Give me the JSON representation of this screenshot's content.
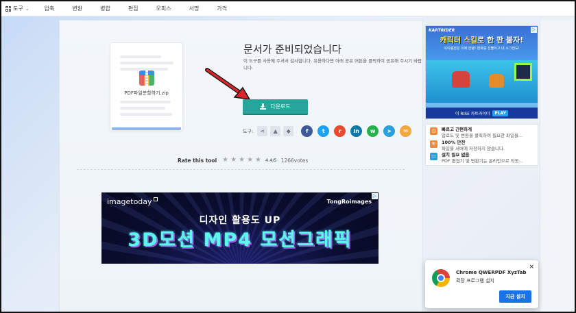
{
  "nav": {
    "tools_label": "도구",
    "items": [
      "압축",
      "변환",
      "병합",
      "편집",
      "오피스",
      "서명",
      "가격"
    ]
  },
  "file": {
    "name": "PDF파일분할하기.zip"
  },
  "result": {
    "title": "문서가 준비되었습니다",
    "subtitle": "이 도구를 사용해 주셔서 감사합니다. 유용하다면 아래 공유 버튼을 클릭하여 공유해 주시기 바랍니다."
  },
  "download": {
    "label": "다운로드"
  },
  "share": {
    "label": "도구:",
    "services": [
      {
        "name": "facebook",
        "glyph": "f",
        "color": "#3b5998"
      },
      {
        "name": "twitter",
        "glyph": "t",
        "color": "#1da1f2"
      },
      {
        "name": "reddit",
        "glyph": "r",
        "color": "#e84a2f"
      },
      {
        "name": "linkedin",
        "glyph": "in",
        "color": "#0e76a8"
      },
      {
        "name": "whatsapp",
        "glyph": "w",
        "color": "#25b24a"
      },
      {
        "name": "telegram",
        "glyph": "➤",
        "color": "#2a9fd8"
      },
      {
        "name": "email",
        "glyph": "✉",
        "color": "#f4a73a"
      }
    ]
  },
  "rating": {
    "label": "Rate this tool",
    "score": "4.4/5",
    "votes": "1266votes",
    "stars_total": 5
  },
  "banner_ad": {
    "brand_left": "imagetoday",
    "brand_right": "TongRoimages",
    "line1": "디자인 활용도 UP",
    "line2": "3D모션 MP4 모션그래픽"
  },
  "side_ad": {
    "logo": "KARTRIDER",
    "title_highlight": "캐릭터 스킬",
    "title_rest": "로 한 판 붙자!",
    "sub": "이이템전은 이제 안녕! 변화를 선물하고 내 소그전도!",
    "cta_text": "이 RISE 카트라이더",
    "cta_button": "PLAY"
  },
  "features": [
    {
      "title": "빠르고 간편하게",
      "desc": "업로드 및 변환을 클릭하여 필요한 파일을...",
      "icon": "clock-icon",
      "color": "#f0883a"
    },
    {
      "title": "100% 안전",
      "desc": "파일을 서버에 저장하지 않습니다.",
      "icon": "shield-icon",
      "color": "#f0883a"
    },
    {
      "title": "설치 필요 없음",
      "desc": "PDF 편집기 및 변환기는 온라인으로 작동...",
      "icon": "monitor-icon",
      "color": "#2a9fd8"
    }
  ],
  "chrome_popup": {
    "title": "Chrome QWERPDF XyzTab",
    "subtitle": "확장 프로그램 설치",
    "button": "지금 설치",
    "close": "×"
  }
}
